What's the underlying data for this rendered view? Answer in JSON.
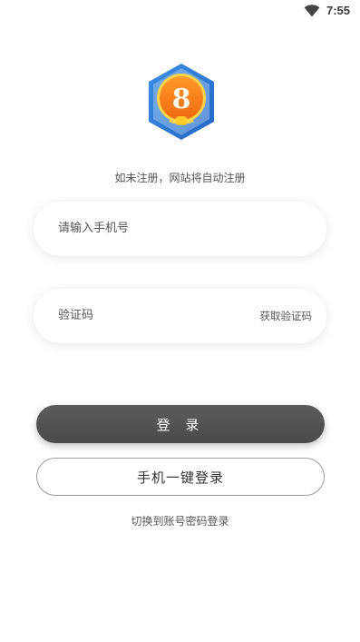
{
  "status_bar": {
    "time": "7:55",
    "wifi_icon": "wifi-icon"
  },
  "logo": {
    "icon": "hexagon-8-badge-logo",
    "digit": "8",
    "colors": {
      "hex": "#2f7fd8",
      "ring": "#f6a21c",
      "inner": "#f37c19"
    }
  },
  "register_hint": "如未注册，网站将自动注册",
  "phone_field": {
    "placeholder": "请输入手机号",
    "value": ""
  },
  "code_field": {
    "placeholder": "验证码",
    "value": "",
    "get_code_label": "获取验证码"
  },
  "login_button": {
    "label": "登 录",
    "color": "#555555"
  },
  "onekey_button": {
    "label": "手机一键登录"
  },
  "switch_link": "切换到账号密码登录"
}
